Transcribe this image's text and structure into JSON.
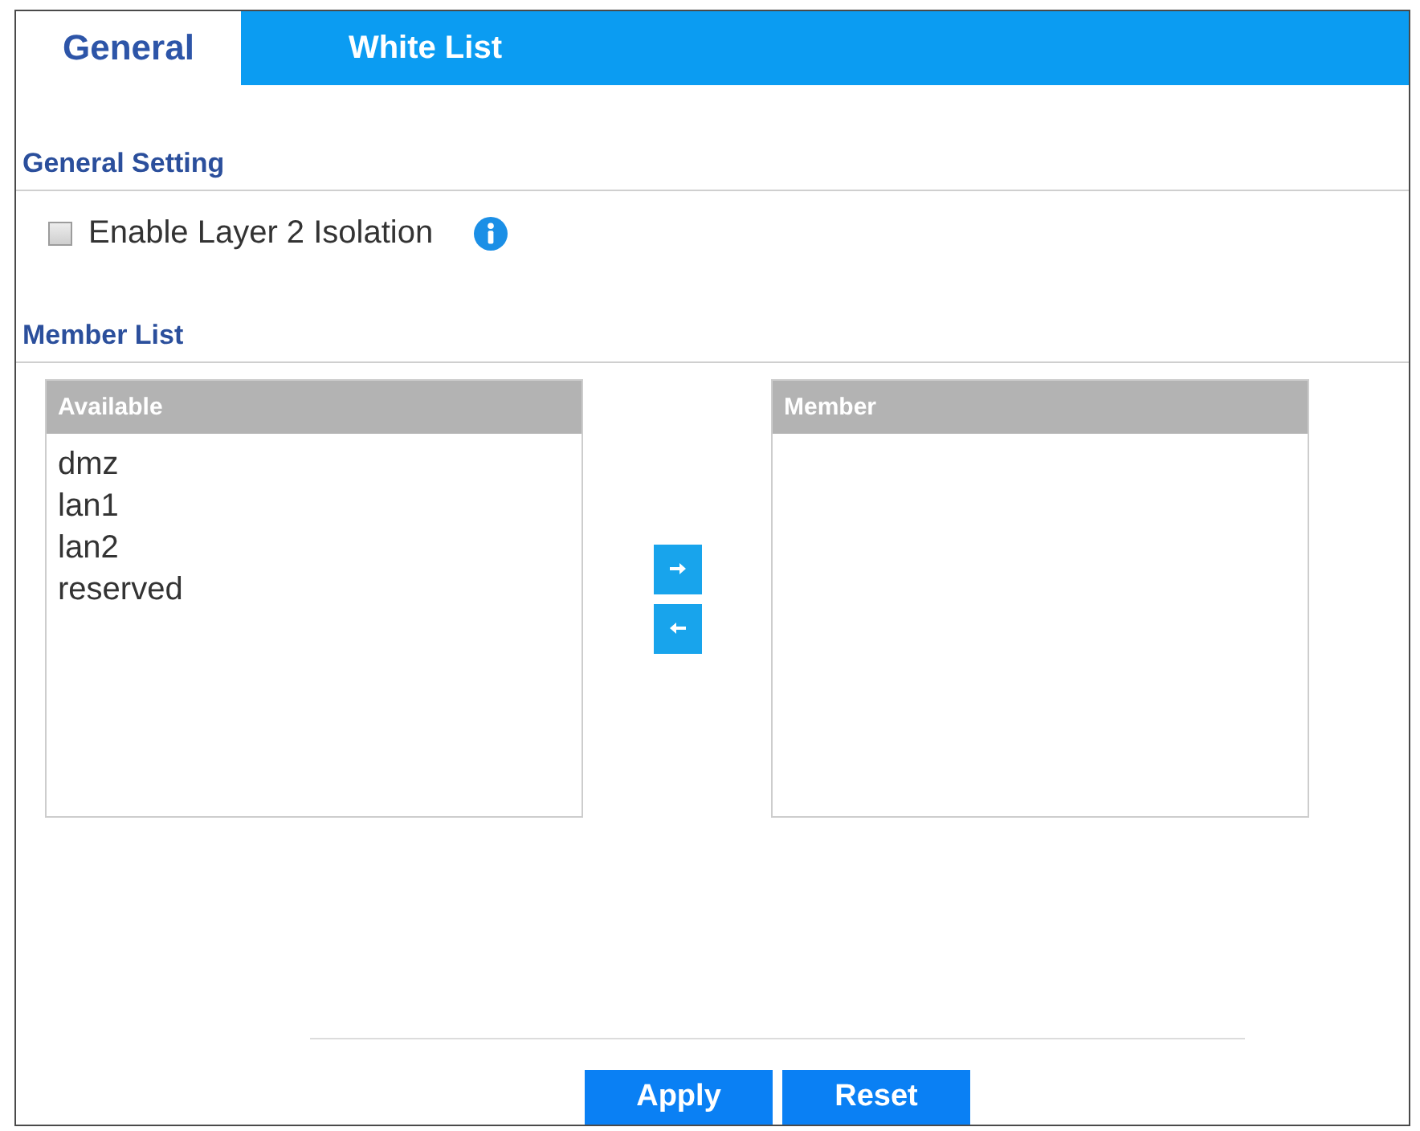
{
  "tabs": [
    {
      "label": "General",
      "selected": true
    },
    {
      "label": "White List",
      "selected": false
    }
  ],
  "general_setting": {
    "title": "General Setting",
    "options": [
      {
        "label": "Enable Layer 2 Isolation",
        "checked": false
      }
    ]
  },
  "member_list": {
    "title": "Member List",
    "available": {
      "header": "Available",
      "items": [
        "dmz",
        "lan1",
        "lan2",
        "reserved"
      ]
    },
    "member": {
      "header": "Member"
    }
  },
  "buttons": [
    "Apply",
    "Reset"
  ]
}
